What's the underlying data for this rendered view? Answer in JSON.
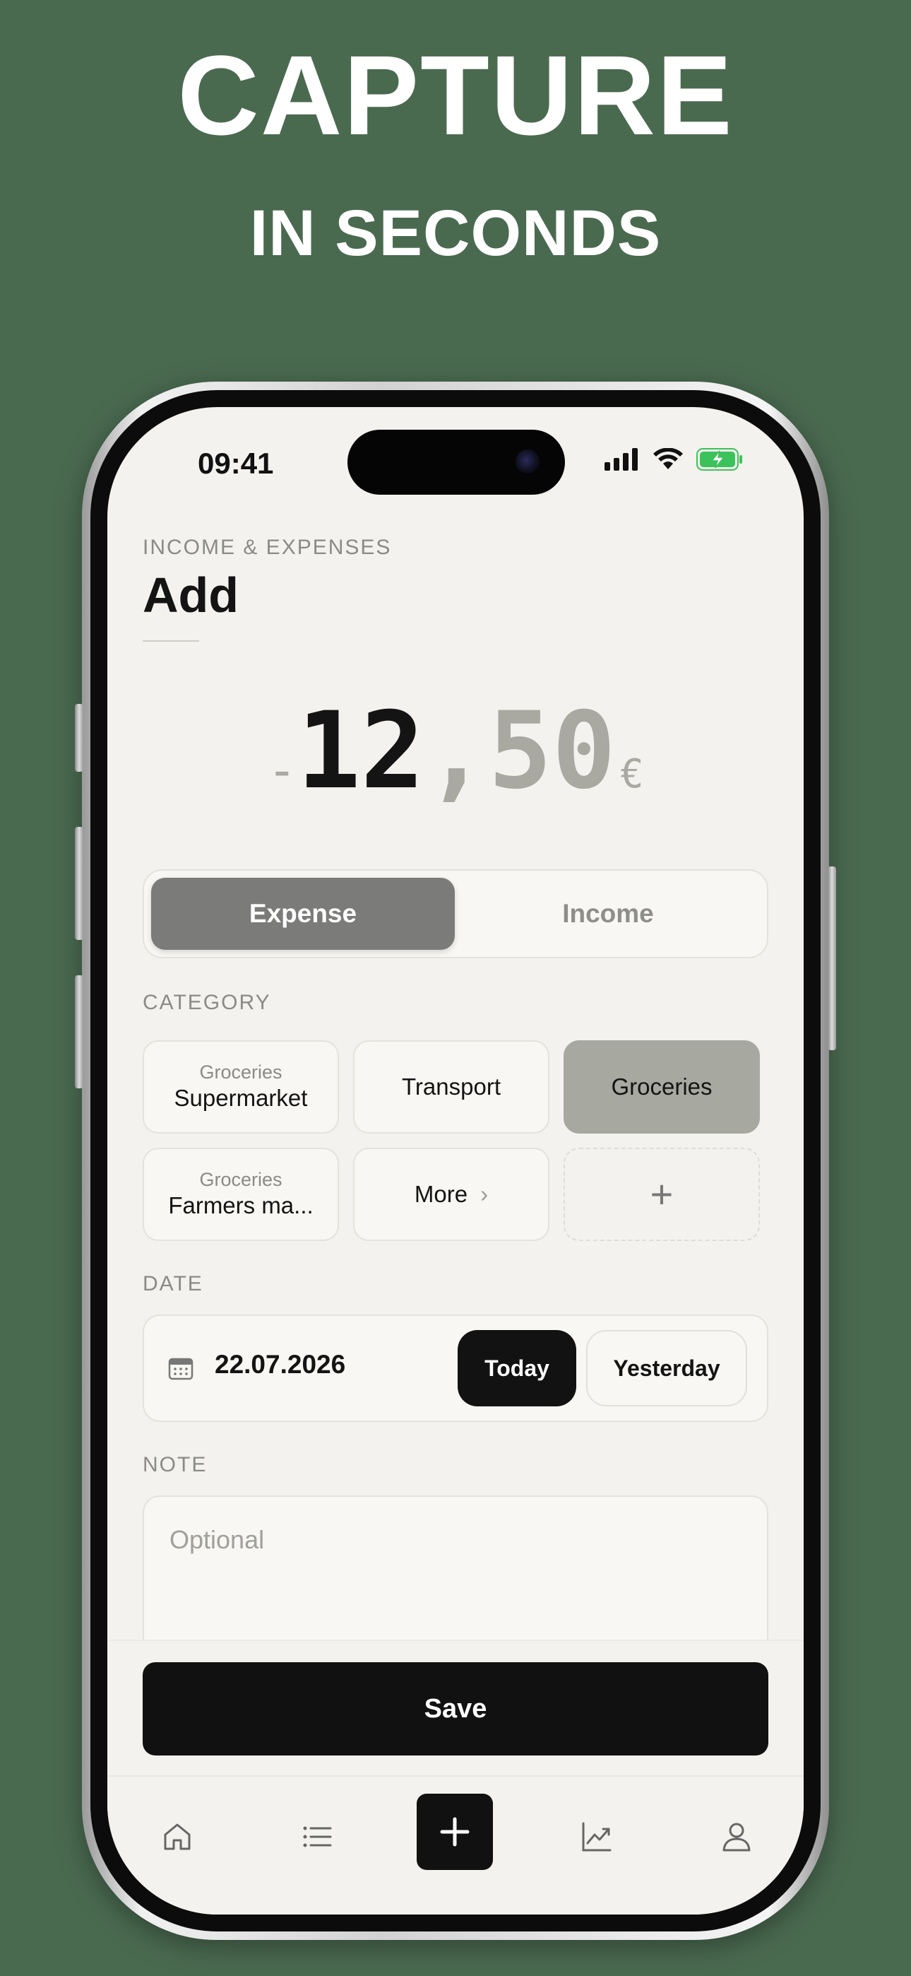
{
  "promo": {
    "headline": "CAPTURE",
    "subheadline": "IN SECONDS"
  },
  "status_bar": {
    "time": "09:41"
  },
  "header": {
    "eyebrow": "INCOME & EXPENSES",
    "title": "Add"
  },
  "amount": {
    "sign": "-",
    "integer": "12",
    "separator": ",",
    "decimals": "50",
    "currency": "€"
  },
  "type_toggle": {
    "expense": "Expense",
    "income": "Income",
    "selected": "Expense"
  },
  "category": {
    "label": "CATEGORY",
    "chips": [
      {
        "sub": "Groceries",
        "main": "Supermarket"
      },
      {
        "sub": "",
        "main": "Transport"
      },
      {
        "sub": "",
        "main": "Groceries",
        "selected": true
      },
      {
        "sub": "Groceries",
        "main": "Farmers ma..."
      },
      {
        "sub": "",
        "main": "More",
        "chevron": "›"
      },
      {
        "sub": "",
        "main": "+"
      }
    ]
  },
  "date": {
    "label": "DATE",
    "value": "22.07.2026",
    "today": "Today",
    "yesterday": "Yesterday"
  },
  "note": {
    "label": "NOTE",
    "placeholder": "Optional"
  },
  "save": {
    "label": "Save"
  },
  "tabbar": {
    "items": [
      "home-icon",
      "list-icon",
      "plus-icon",
      "chart-icon",
      "profile-icon"
    ],
    "active": "plus-icon"
  },
  "colors": {
    "background": "#4a6a50",
    "screen": "#f3f2ee",
    "accent": "#111111",
    "selected_chip": "#a7a8a0",
    "battery": "#3cc25a"
  }
}
